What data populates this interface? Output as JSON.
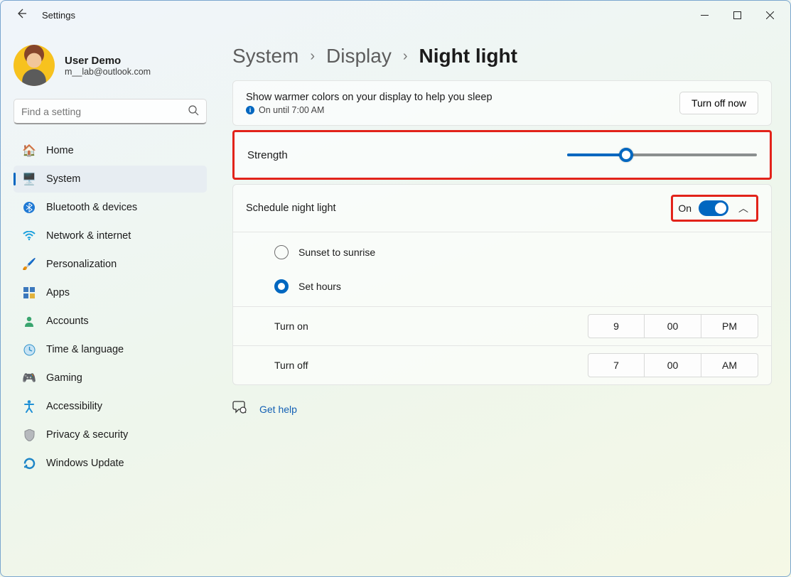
{
  "window": {
    "title": "Settings"
  },
  "profile": {
    "name": "User Demo",
    "email": "m__lab@outlook.com"
  },
  "search": {
    "placeholder": "Find a setting"
  },
  "nav": {
    "items": [
      {
        "label": "Home"
      },
      {
        "label": "System"
      },
      {
        "label": "Bluetooth & devices"
      },
      {
        "label": "Network & internet"
      },
      {
        "label": "Personalization"
      },
      {
        "label": "Apps"
      },
      {
        "label": "Accounts"
      },
      {
        "label": "Time & language"
      },
      {
        "label": "Gaming"
      },
      {
        "label": "Accessibility"
      },
      {
        "label": "Privacy & security"
      },
      {
        "label": "Windows Update"
      }
    ]
  },
  "breadcrumb": {
    "a": "System",
    "b": "Display",
    "c": "Night light"
  },
  "status": {
    "title": "Show warmer colors on your display to help you sleep",
    "subtitle": "On until 7:00 AM",
    "button": "Turn off now"
  },
  "strength": {
    "label": "Strength",
    "value": 31
  },
  "schedule": {
    "label": "Schedule night light",
    "toggle_state": "On",
    "radio_sunset": "Sunset to sunrise",
    "radio_hours": "Set hours",
    "turn_on_label": "Turn on",
    "turn_on": {
      "h": "9",
      "m": "00",
      "ap": "PM"
    },
    "turn_off_label": "Turn off",
    "turn_off": {
      "h": "7",
      "m": "00",
      "ap": "AM"
    }
  },
  "help": {
    "label": "Get help"
  }
}
